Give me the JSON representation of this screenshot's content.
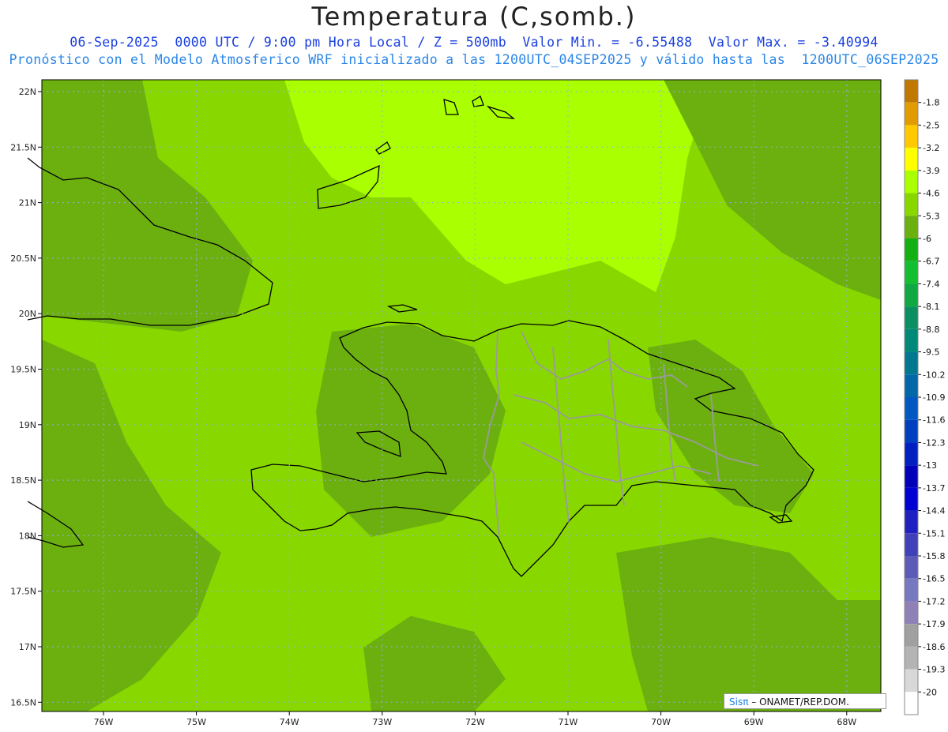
{
  "title": "Temperatura (C,somb.)",
  "subtitle1": "06-Sep-2025  0000 UTC / 9:00 pm Hora Local / Z = 500mb  Valor Min. = -6.55488  Valor Max. = -3.40994",
  "subtitle2": "Pronóstico con el Modelo Atmosferico WRF inicializado a las 1200UTC_04SEP2025 y válido hasta las  1200UTC_06SEP2025",
  "credit": {
    "prefix": "Sisπ",
    "suffix": "– ONAMET/REP.DOM."
  },
  "lat_labels": [
    "22N",
    "21.5N",
    "21N",
    "20.5N",
    "20N",
    "19.5N",
    "19N",
    "18.5N",
    "18N",
    "17.5N",
    "17N",
    "16.5N"
  ],
  "lon_labels": [
    "76W",
    "75W",
    "74W",
    "73W",
    "72W",
    "71W",
    "70W",
    "69W",
    "68W"
  ],
  "colorbar": [
    {
      "label": "-1.8",
      "color": "#c07800"
    },
    {
      "label": "-2.5",
      "color": "#e09c00"
    },
    {
      "label": "-3.2",
      "color": "#ffc800"
    },
    {
      "label": "-3.9",
      "color": "#ffff00"
    },
    {
      "label": "-4.6",
      "color": "#aaff00"
    },
    {
      "label": "-5.3",
      "color": "#88d800"
    },
    {
      "label": "-6",
      "color": "#6cb010"
    },
    {
      "label": "-6.7",
      "color": "#12b012"
    },
    {
      "label": "-7.4",
      "color": "#12bf30"
    },
    {
      "label": "-8.1",
      "color": "#10a840"
    },
    {
      "label": "-8.8",
      "color": "#0a9060"
    },
    {
      "label": "-9.5",
      "color": "#008878"
    },
    {
      "label": "-10.2",
      "color": "#007890"
    },
    {
      "label": "-10.9",
      "color": "#0068a8"
    },
    {
      "label": "-11.6",
      "color": "#0058c0"
    },
    {
      "label": "-12.3",
      "color": "#0040c0"
    },
    {
      "label": "-13",
      "color": "#0020c0"
    },
    {
      "label": "-13.7",
      "color": "#0000b8"
    },
    {
      "label": "-14.4",
      "color": "#0000d0"
    },
    {
      "label": "-15.1",
      "color": "#2020c0"
    },
    {
      "label": "-15.8",
      "color": "#4040b8"
    },
    {
      "label": "-16.5",
      "color": "#5c5cb8"
    },
    {
      "label": "-17.2",
      "color": "#7878c0"
    },
    {
      "label": "-17.9",
      "color": "#9080b8"
    },
    {
      "label": "-18.6",
      "color": "#a0a0a0"
    },
    {
      "label": "-19.3",
      "color": "#b4b4b4"
    },
    {
      "label": "-20",
      "color": "#d8d8d8"
    },
    {
      "label": "",
      "color": "#ffffff"
    }
  ],
  "field_colors": {
    "base": "#88d800",
    "light": "#aaff00",
    "dark": "#6cb010"
  }
}
